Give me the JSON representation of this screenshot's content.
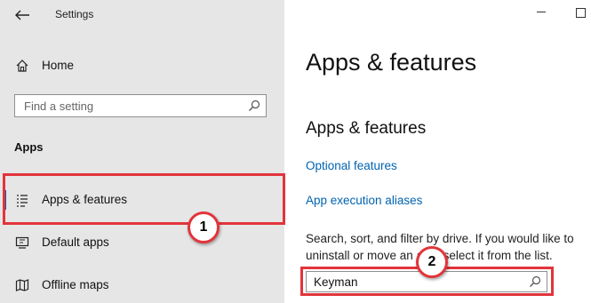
{
  "window": {
    "title": "Settings"
  },
  "sidebar": {
    "home_label": "Home",
    "search_placeholder": "Find a setting",
    "section_label": "Apps",
    "items": [
      {
        "label": "Apps & features",
        "icon": "apps-features-icon",
        "selected": true
      },
      {
        "label": "Default apps",
        "icon": "default-apps-icon"
      },
      {
        "label": "Offline maps",
        "icon": "offline-maps-icon"
      }
    ]
  },
  "main": {
    "page_title": "Apps & features",
    "section_title": "Apps & features",
    "links": [
      "Optional features",
      "App execution aliases"
    ],
    "description": "Search, sort, and filter by drive. If you would like to uninstall or move an app, select it from the list.",
    "search_value": "Keyman"
  },
  "annotations": [
    "1",
    "2"
  ],
  "colors": {
    "accent": "#0063b1",
    "callout": "#e2343b",
    "sidebar_bg": "#e6e6e6"
  }
}
